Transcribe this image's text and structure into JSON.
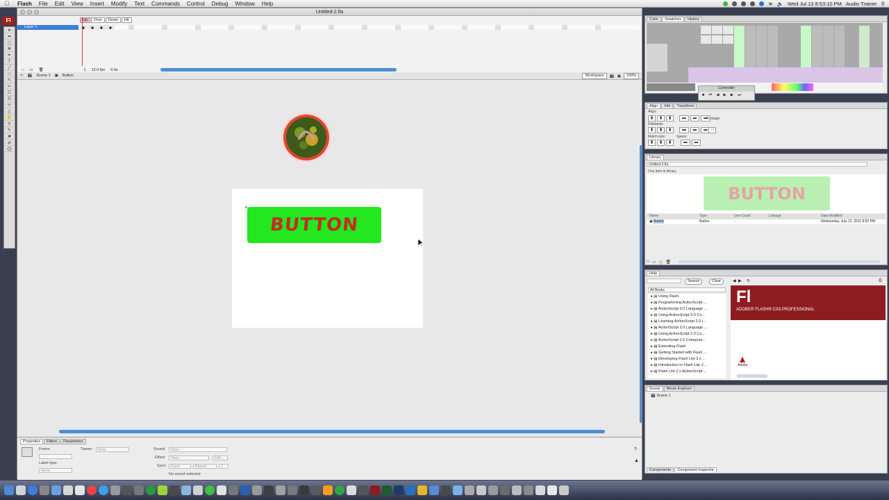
{
  "menubar": {
    "app": "Flash",
    "items": [
      "File",
      "Edit",
      "View",
      "Insert",
      "Modify",
      "Text",
      "Commands",
      "Control",
      "Debug",
      "Window",
      "Help"
    ],
    "clock": "Wed Jul 13  8:53:10 PM",
    "user": "Audio Trainer"
  },
  "window": {
    "title": "Untitled-2.fla"
  },
  "timeline": {
    "layer_name": "Layer 1",
    "states": [
      "Up",
      "Over",
      "Down",
      "Hit"
    ],
    "frame": "1",
    "fps": "12.0 fps",
    "time": "0.0s"
  },
  "editbar": {
    "scene": "Scene 1",
    "symbol": "Button",
    "workspace": "Workspace",
    "zoom": "100%"
  },
  "stage": {
    "button_label": "BUTTON",
    "button_color": "#22e81d",
    "label_color": "#c52b23"
  },
  "properties": {
    "tabs": [
      "Properties",
      "Filters",
      "Parameters"
    ],
    "frame_label": "Frame",
    "tween_label": "Tween:",
    "tween_value": "None",
    "sound_label": "Sound:",
    "sound_value": "None",
    "effect_label": "Effect:",
    "effect_value": "None",
    "edit_button": "Edit...",
    "sync_label": "Sync:",
    "sync_value": "Event",
    "repeat_value": "Repeat",
    "repeat_count": "1",
    "label_type": "Label type:",
    "label_type_value": "Name",
    "no_sound": "No sound selected"
  },
  "swatches_panel": {
    "tabs": [
      "Color",
      "Swatches",
      "History"
    ],
    "controller": "Controller"
  },
  "align_panel": {
    "tabs": [
      "Align",
      "Info",
      "Transform"
    ],
    "align": "Align:",
    "distribute": "Distribute:",
    "match_size": "Match size:",
    "space": "Space:",
    "to_stage": "To stage:"
  },
  "library": {
    "tab": "Library",
    "file": "Untitled-2.fla",
    "count": "One item in library",
    "preview_label": "BUTTON",
    "columns": [
      "Name",
      "Type",
      "Use Count",
      "Linkage",
      "Date Modified"
    ],
    "row": {
      "name": "Button",
      "type": "Button",
      "use_count": "-",
      "date": "Wednesday, July 13, 2011  8:52 PM"
    }
  },
  "help": {
    "tab": "Help",
    "search_button": "Search",
    "clear_button": "Clear",
    "books_select": "All Books",
    "books": [
      "Using Flash",
      "Programming ActionScript ...",
      "ActionScript 3.0 Language ...",
      "Using ActionScript 3.0 Co...",
      "Learning ActionScript 2.0 i...",
      "ActionScript 2.0 Language ...",
      "Using ActionScript 2.0 Co...",
      "ActionScript 2.0 Compone...",
      "Extending Flash",
      "Getting Started with Flash ...",
      "Developing Flash Lite 2.x ...",
      "Introduction to Flash Lite 2...",
      "Flash Lite 2.x ActionScript ..."
    ],
    "banner_logo": "Fl",
    "banner_title": "ADOBE® FLASH® CS3 PROFESSIONAL",
    "adobe": "Adobe"
  },
  "scene_panel": {
    "tabs": [
      "Scene",
      "Movie Explorer"
    ],
    "item": "Scene 1",
    "bottom_tabs": [
      "Components",
      "Component Inspector"
    ]
  },
  "toolbar_icon": "Fl"
}
